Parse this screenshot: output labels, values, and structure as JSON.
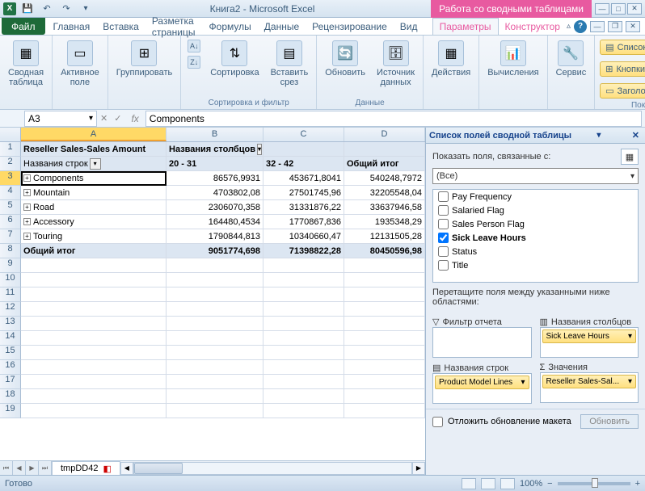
{
  "titlebar": {
    "app_title": "Книга2 - Microsoft Excel",
    "context_tab": "Работа со сводными таблицами"
  },
  "file_tab": "Файл",
  "menu_tabs": [
    "Главная",
    "Вставка",
    "Разметка страницы",
    "Формулы",
    "Данные",
    "Рецензирование",
    "Вид"
  ],
  "ctx_tabs": [
    "Параметры",
    "Конструктор"
  ],
  "ribbon": {
    "groups": {
      "g0": {
        "pivot": "Сводная\nтаблица",
        "field": "Активное\nполе",
        "group": "Группировать"
      },
      "sort": {
        "btn": "Сортировка",
        "slicer": "Вставить\nсрез",
        "label": "Сортировка и фильтр"
      },
      "data": {
        "refresh": "Обновить",
        "source": "Источник\nданных",
        "label": "Данные"
      },
      "actions": {
        "btn": "Действия",
        "calc": "Вычисления",
        "tools": "Сервис"
      },
      "show": {
        "fields": "Список полей",
        "buttons": "Кнопки +/-",
        "headers": "Заголовки полей",
        "label": "Показать"
      }
    }
  },
  "namebox": "A3",
  "formula": "Components",
  "cols": {
    "A": 180,
    "B": 120,
    "C": 100,
    "D": 100
  },
  "pivot": {
    "r1": "Reseller Sales-Sales Amount",
    "r1b": "Названия столбцов",
    "r2a": "Названия строк",
    "r2b": "20 - 31",
    "r2c": "32 - 42",
    "r2d": "Общий итог",
    "rows": [
      {
        "label": "Components",
        "b": "86576,9931",
        "c": "453671,8041",
        "d": "540248,7972"
      },
      {
        "label": "Mountain",
        "b": "4703802,08",
        "c": "27501745,96",
        "d": "32205548,04"
      },
      {
        "label": "Road",
        "b": "2306070,358",
        "c": "31331876,22",
        "d": "33637946,58"
      },
      {
        "label": "Accessory",
        "b": "164480,4534",
        "c": "1770867,836",
        "d": "1935348,29"
      },
      {
        "label": "Touring",
        "b": "1790844,813",
        "c": "10340660,47",
        "d": "12131505,28"
      }
    ],
    "total": {
      "label": "Общий итог",
      "b": "9051774,698",
      "c": "71398822,28",
      "d": "80450596,98"
    }
  },
  "sheet_tab": "tmpDD42",
  "task_pane": {
    "title": "Список полей сводной таблицы",
    "show_related": "Показать поля, связанные с:",
    "combo": "(Все)",
    "fields": [
      {
        "label": "Pay Frequency",
        "checked": false
      },
      {
        "label": "Salaried Flag",
        "checked": false
      },
      {
        "label": "Sales Person Flag",
        "checked": false
      },
      {
        "label": "Sick Leave Hours",
        "checked": true
      },
      {
        "label": "Status",
        "checked": false
      },
      {
        "label": "Title",
        "checked": false
      }
    ],
    "drag_hint": "Перетащите поля между указанными ниже областями:",
    "area_filter": "Фильтр отчета",
    "area_cols": "Названия столбцов",
    "area_rows": "Названия строк",
    "area_vals": "Значения",
    "item_cols": "Sick Leave Hours",
    "item_rows": "Product Model Lines",
    "item_vals": "Reseller Sales-Sal...",
    "defer": "Отложить обновление макета",
    "update": "Обновить"
  },
  "status": {
    "ready": "Готово",
    "zoom": "100%"
  },
  "chart_data": {
    "type": "table",
    "title": "Reseller Sales-Sales Amount",
    "row_dimension": "Названия строк (Product Model Lines)",
    "col_dimension": "Названия столбцов (Sick Leave Hours)",
    "columns": [
      "20 - 31",
      "32 - 42",
      "Общий итог"
    ],
    "rows": [
      {
        "label": "Components",
        "values": [
          86576.9931,
          453671.8041,
          540248.7972
        ]
      },
      {
        "label": "Mountain",
        "values": [
          4703802.08,
          27501745.96,
          32205548.04
        ]
      },
      {
        "label": "Road",
        "values": [
          2306070.358,
          31331876.22,
          33637946.58
        ]
      },
      {
        "label": "Accessory",
        "values": [
          164480.4534,
          1770867.836,
          1935348.29
        ]
      },
      {
        "label": "Touring",
        "values": [
          1790844.813,
          10340660.47,
          12131505.28
        ]
      }
    ],
    "grand_total": {
      "label": "Общий итог",
      "values": [
        9051774.698,
        71398822.28,
        80450596.98
      ]
    }
  }
}
